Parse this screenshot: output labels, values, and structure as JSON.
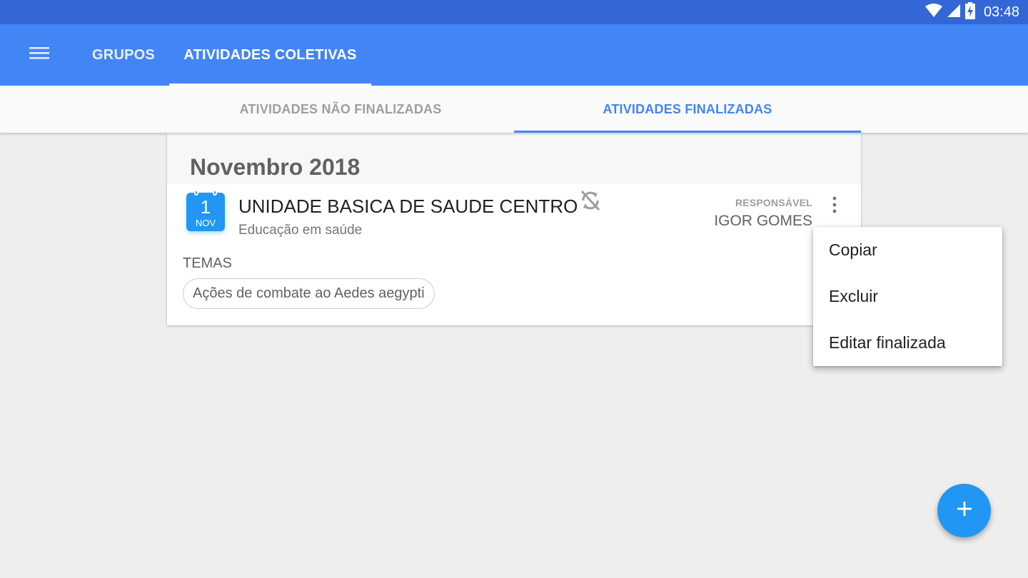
{
  "status_bar": {
    "time": "03:48"
  },
  "app_bar": {
    "tabs": [
      {
        "label": "GRUPOS",
        "selected": false
      },
      {
        "label": "ATIVIDADES COLETIVAS",
        "selected": true
      }
    ]
  },
  "sub_tabs": [
    {
      "label": "ATIVIDADES NÃO FINALIZADAS",
      "selected": false
    },
    {
      "label": "ATIVIDADES FINALIZADAS",
      "selected": true
    }
  ],
  "section": {
    "month_title": "Novembro 2018",
    "activity": {
      "date_day": "1",
      "date_month": "NOV",
      "unit_name": "UNIDADE BASICA DE SAUDE CENTRO",
      "type": "Educação em saúde",
      "responsible_label": "RESPONSÁVEL",
      "responsible_name": "IGOR GOMES",
      "themes_label": "TEMAS",
      "themes": [
        "Ações de combate ao Aedes aegypti"
      ]
    }
  },
  "popup_menu": {
    "items": [
      "Copiar",
      "Excluir",
      "Editar finalizada"
    ]
  },
  "icons": {
    "menu": "hamburger-menu-icon",
    "sync": "sync-disabled-icon",
    "overflow": "more-vert-icon",
    "fab": "plus-icon",
    "wifi": "wifi-icon",
    "signal": "cell-signal-icon",
    "battery": "battery-charging-icon"
  },
  "colors": {
    "status_bar": "#3367d6",
    "app_bar": "#4285f4",
    "accent": "#2196f3",
    "selected_subtab": "#4285f4"
  }
}
